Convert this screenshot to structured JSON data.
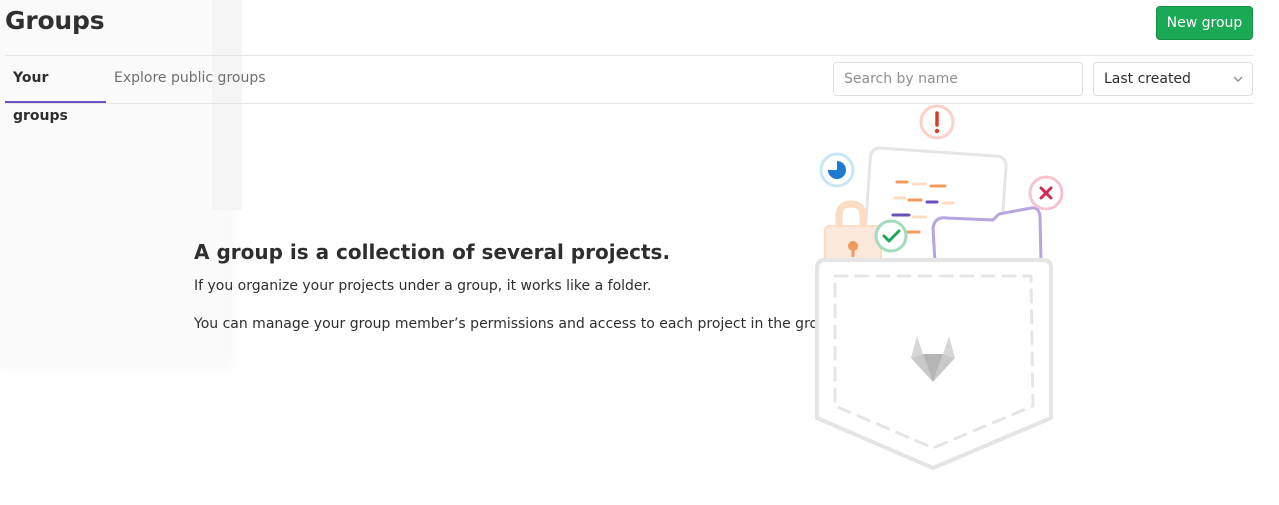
{
  "header": {
    "title": "Groups",
    "new_group_label": "New group"
  },
  "tabs": [
    {
      "label": "Your groups",
      "active": true
    },
    {
      "label": "Explore public groups",
      "active": false
    }
  ],
  "filters": {
    "search_placeholder": "Search by name",
    "search_value": "",
    "sort_selected": "Last created"
  },
  "empty_state": {
    "title": "A group is a collection of several projects.",
    "lines": [
      "If you organize your projects under a group, it works like a folder.",
      "You can manage your group member’s permissions and access to each project in the group."
    ]
  },
  "colors": {
    "primary_green": "#1aaa55",
    "tab_underline": "#6b4fbb",
    "text": "#2e2e2e",
    "muted_text": "#707070",
    "border": "#e5e5e5"
  },
  "icons": [
    "chevron-down-icon",
    "empty-groups-illustration",
    "warning-icon",
    "pie-icon",
    "error-x-icon",
    "check-icon",
    "lock-icon",
    "folder-icon",
    "gitlab-tanuki-icon"
  ]
}
